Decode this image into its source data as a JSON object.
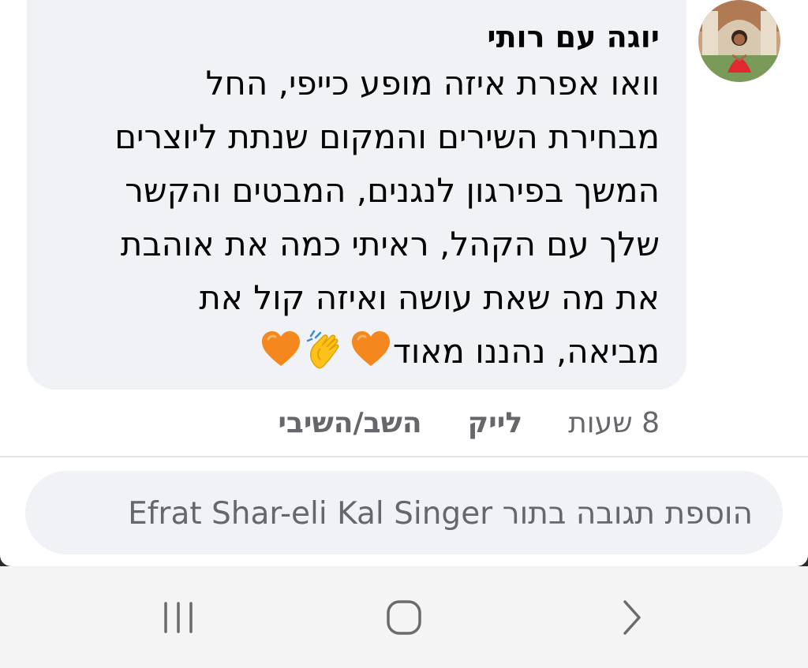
{
  "comment": {
    "author": "יוגה עם רותי",
    "lines": [
      "וואו אפרת איזה מופע כייפי, החל",
      "מבחירת השירים והמקום שנתת ליוצרים",
      "המשך בפירגון לנגנים, המבטים והקשר",
      "שלך עם הקהל, ראיתי כמה את אוהבת",
      "את מה שאת עושה ואיזה קול את",
      "מביאה, נהננו מאוד"
    ],
    "emojis": [
      "orange-heart",
      "clapping-hands",
      "orange-heart"
    ]
  },
  "actions": {
    "time": "8 שעות",
    "like": "לייק",
    "reply": "השב/השיבי"
  },
  "reply_input": {
    "placeholder": "הוספת תגובה בתור Efrat Shar-eli Kal Singer"
  },
  "navbar": {
    "icons": [
      "recent-apps-icon",
      "home-icon",
      "back-icon"
    ]
  },
  "colors": {
    "bubble": "#f0f2f5",
    "secondary_text": "#65676b",
    "heart": "#f5871f"
  }
}
